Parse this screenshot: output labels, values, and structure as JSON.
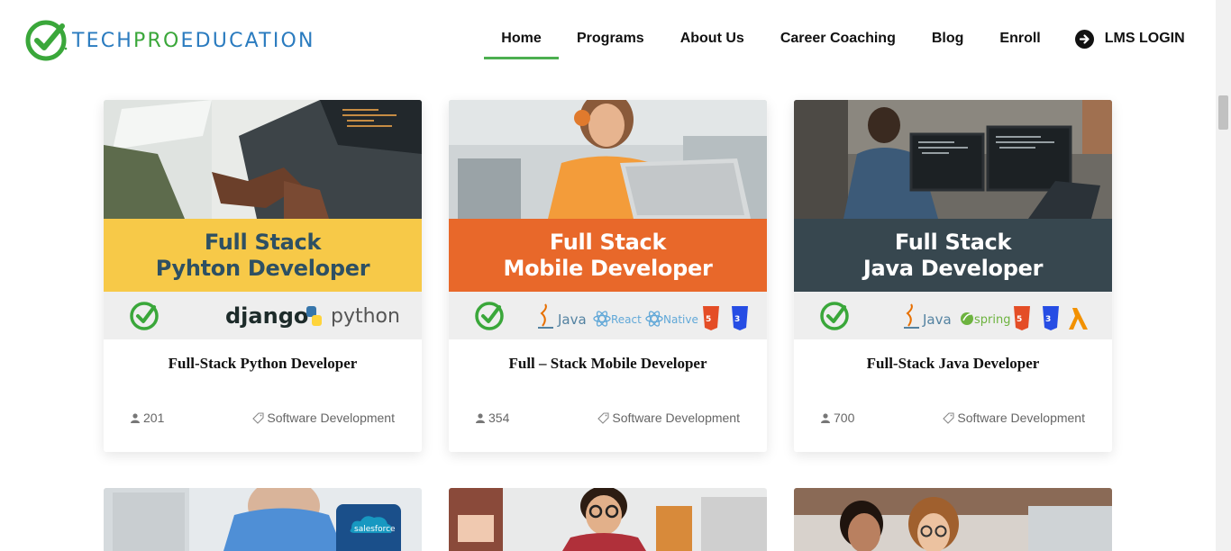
{
  "brand": {
    "logo_text_a": "TECH",
    "logo_text_b": "PRO",
    "logo_text_c": "EDUCATION"
  },
  "nav": {
    "home": "Home",
    "programs": "Programs",
    "about": "About Us",
    "career": "Career Coaching",
    "blog": "Blog",
    "enroll": "Enroll",
    "lms": "LMS LOGIN"
  },
  "colors": {
    "accent": "#4caf50",
    "brand_blue": "#2a7bbf",
    "brand_green": "#3aa73a"
  },
  "courses": [
    {
      "title": "Full-Stack Python Developer",
      "banner_line1": "Full Stack",
      "banner_line2": "Pyhton Developer",
      "banner_color": "#f7c948",
      "banner_text_color": "#2e5063",
      "tech": [
        "django",
        "python"
      ],
      "students": "201",
      "category": "Software Development"
    },
    {
      "title": "Full – Stack Mobile Developer",
      "banner_line1": "Full Stack",
      "banner_line2": "Mobile Developer",
      "banner_color": "#e8682a",
      "banner_text_color": "#ffffff",
      "tech": [
        "Java",
        "React",
        "Native",
        "HTML",
        "CSS"
      ],
      "students": "354",
      "category": "Software Development"
    },
    {
      "title": "Full-Stack Java Developer",
      "banner_line1": "Full Stack",
      "banner_line2": "Java Developer",
      "banner_color": "#37474f",
      "banner_text_color": "#ffffff",
      "tech": [
        "Java",
        "spring",
        "HTML",
        "CSS",
        "LAMBDA"
      ],
      "students": "700",
      "category": "Software Development"
    }
  ],
  "lower_cards": [
    {
      "badge": "salesforce"
    }
  ]
}
